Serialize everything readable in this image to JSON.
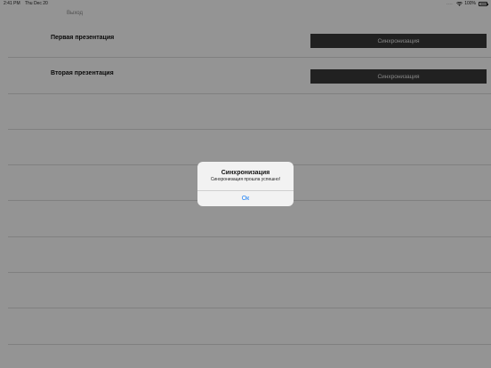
{
  "status_bar": {
    "time": "2:41 PM",
    "date": "Thu Dec 20",
    "signal": "....",
    "battery": "100%",
    "icons": [
      "wifi-icon",
      "battery-icon"
    ]
  },
  "nav": {
    "exit_label": "Выход"
  },
  "presentations": [
    {
      "title": "Первая презентация",
      "button_label": "Синхронизация"
    },
    {
      "title": "Вторая презентация",
      "button_label": "Синхронизация"
    }
  ],
  "alert": {
    "title": "Синхронизация",
    "message": "Синхронизация прошла успешно!",
    "ok_label": "Ок"
  },
  "colors": {
    "button_bg": "#3a3a3a",
    "alert_button": "#1a7ff5",
    "separator": "#dcdcdc",
    "overlay": "rgba(0,0,0,0.42)"
  }
}
